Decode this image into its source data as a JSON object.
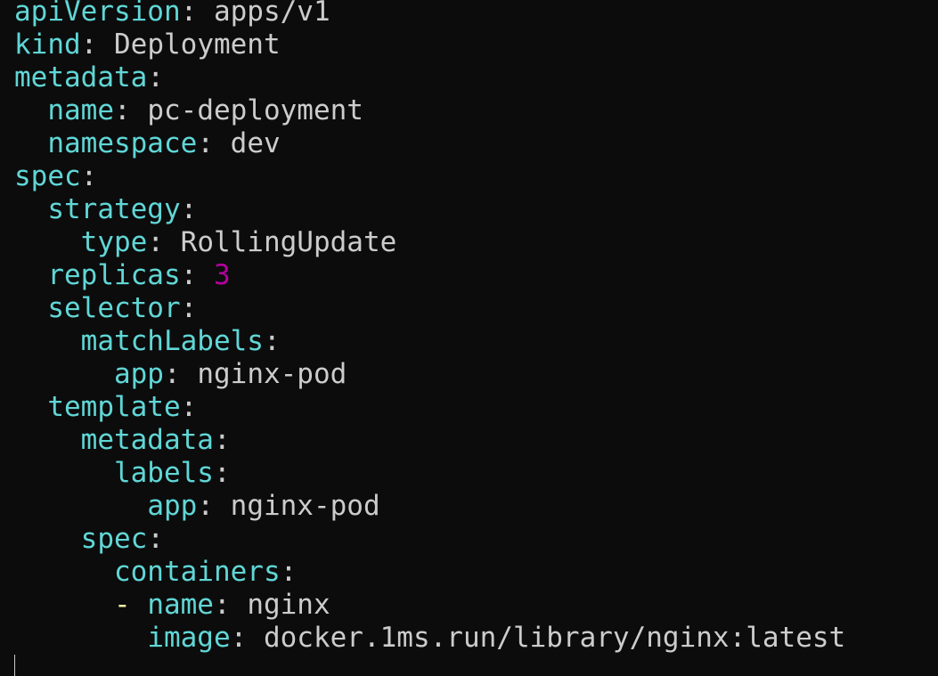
{
  "colors": {
    "background": "#0c0c0c",
    "key": "#61d6d6",
    "text": "#cccccc",
    "number": "#b4009e",
    "dash": "#f9f1a5"
  },
  "lines": [
    {
      "indent": "",
      "dash": "",
      "key": "apiVersion",
      "value": "apps/v1",
      "type": "text"
    },
    {
      "indent": "",
      "dash": "",
      "key": "kind",
      "value": "Deployment",
      "type": "text"
    },
    {
      "indent": "",
      "dash": "",
      "key": "metadata",
      "value": "",
      "type": "text"
    },
    {
      "indent": "  ",
      "dash": "",
      "key": "name",
      "value": "pc-deployment",
      "type": "text"
    },
    {
      "indent": "  ",
      "dash": "",
      "key": "namespace",
      "value": "dev",
      "type": "text"
    },
    {
      "indent": "",
      "dash": "",
      "key": "spec",
      "value": "",
      "type": "text"
    },
    {
      "indent": "  ",
      "dash": "",
      "key": "strategy",
      "value": "",
      "type": "text"
    },
    {
      "indent": "    ",
      "dash": "",
      "key": "type",
      "value": "RollingUpdate",
      "type": "text"
    },
    {
      "indent": "  ",
      "dash": "",
      "key": "replicas",
      "value": "3",
      "type": "number"
    },
    {
      "indent": "  ",
      "dash": "",
      "key": "selector",
      "value": "",
      "type": "text"
    },
    {
      "indent": "    ",
      "dash": "",
      "key": "matchLabels",
      "value": "",
      "type": "text"
    },
    {
      "indent": "      ",
      "dash": "",
      "key": "app",
      "value": "nginx-pod",
      "type": "text"
    },
    {
      "indent": "  ",
      "dash": "",
      "key": "template",
      "value": "",
      "type": "text"
    },
    {
      "indent": "    ",
      "dash": "",
      "key": "metadata",
      "value": "",
      "type": "text"
    },
    {
      "indent": "      ",
      "dash": "",
      "key": "labels",
      "value": "",
      "type": "text"
    },
    {
      "indent": "        ",
      "dash": "",
      "key": "app",
      "value": "nginx-pod",
      "type": "text"
    },
    {
      "indent": "    ",
      "dash": "",
      "key": "spec",
      "value": "",
      "type": "text"
    },
    {
      "indent": "      ",
      "dash": "",
      "key": "containers",
      "value": "",
      "type": "text"
    },
    {
      "indent": "      ",
      "dash": "- ",
      "key": "name",
      "value": "nginx",
      "type": "text"
    },
    {
      "indent": "        ",
      "dash": "",
      "key": "image",
      "value": "docker.1ms.run/library/nginx:latest",
      "type": "text"
    }
  ]
}
